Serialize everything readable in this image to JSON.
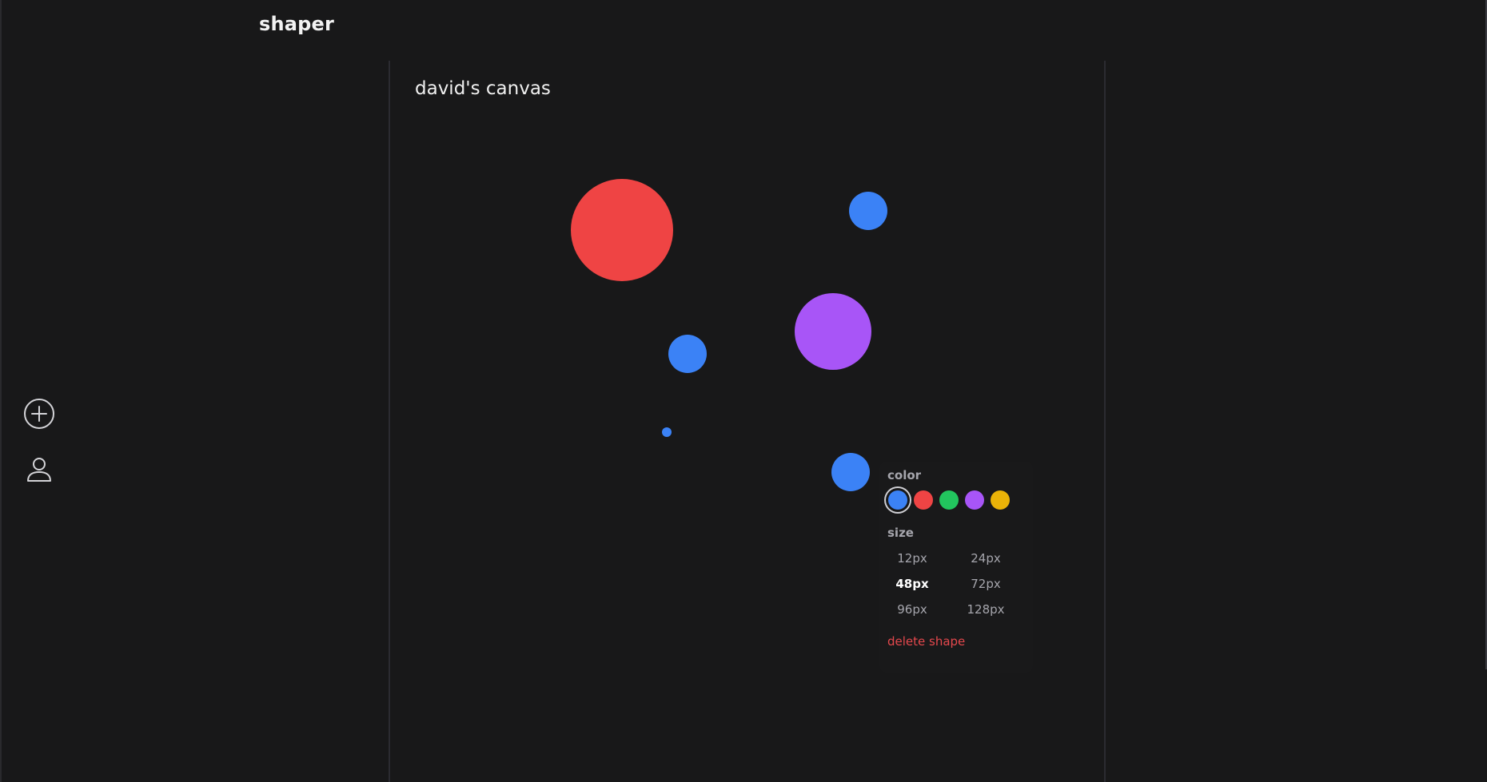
{
  "app": {
    "brand": "shaper"
  },
  "toolbar": {
    "items": [
      {
        "icon": "plus-circle-icon"
      },
      {
        "icon": "user-icon"
      }
    ]
  },
  "canvas": {
    "title": "david's canvas",
    "shapes": [
      {
        "color": "#ef4444",
        "size": "128px"
      },
      {
        "color": "#3b82f6",
        "size": "48px"
      },
      {
        "color": "#a855f7",
        "size": "96px"
      },
      {
        "color": "#3b82f6",
        "size": "48px"
      },
      {
        "color": "#3b82f6",
        "size": "12px"
      },
      {
        "color": "#3b82f6",
        "size": "48px",
        "selected": true
      }
    ]
  },
  "popover": {
    "color_label": "color",
    "size_label": "size",
    "colors": [
      {
        "name": "blue",
        "hex": "#3b82f6",
        "selected": true
      },
      {
        "name": "red",
        "hex": "#ef4444"
      },
      {
        "name": "green",
        "hex": "#22c55e"
      },
      {
        "name": "purple",
        "hex": "#a855f7"
      },
      {
        "name": "yellow",
        "hex": "#eab308"
      }
    ],
    "sizes": [
      "12px",
      "24px",
      "48px",
      "72px",
      "96px",
      "128px"
    ],
    "selected_size": "48px",
    "delete_label": "delete shape"
  }
}
